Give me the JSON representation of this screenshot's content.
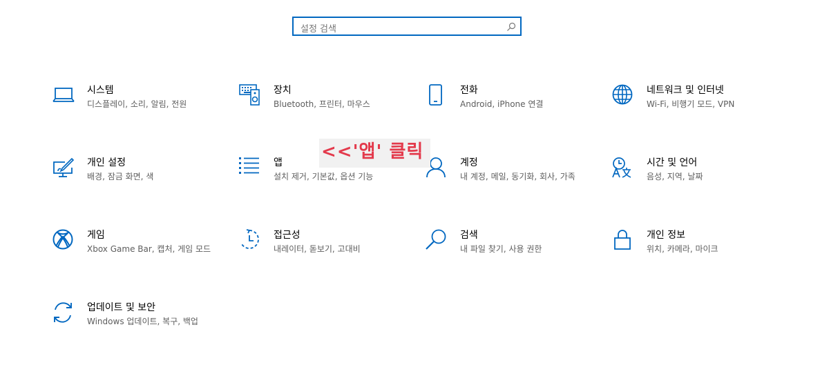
{
  "search": {
    "placeholder": "설정 검색"
  },
  "tiles": [
    {
      "title": "시스템",
      "desc": "디스플레이, 소리, 알림, 전원",
      "icon": "laptop-icon"
    },
    {
      "title": "장치",
      "desc": "Bluetooth, 프린터, 마우스",
      "icon": "devices-icon"
    },
    {
      "title": "전화",
      "desc": "Android, iPhone 연결",
      "icon": "phone-icon"
    },
    {
      "title": "네트워크 및 인터넷",
      "desc": "Wi-Fi, 비행기 모드, VPN",
      "icon": "globe-icon"
    },
    {
      "title": "개인 설정",
      "desc": "배경, 잠금 화면, 색",
      "icon": "personalization-icon"
    },
    {
      "title": "앱",
      "desc": "설치 제거, 기본값, 옵션 기능",
      "icon": "apps-list-icon"
    },
    {
      "title": "계정",
      "desc": "내 계정, 메일, 동기화, 회사, 가족",
      "icon": "person-icon"
    },
    {
      "title": "시간 및 언어",
      "desc": "음성, 지역, 날짜",
      "icon": "time-language-icon"
    },
    {
      "title": "게임",
      "desc": "Xbox Game Bar, 캡처, 게임 모드",
      "icon": "xbox-icon"
    },
    {
      "title": "접근성",
      "desc": "내레이터, 돋보기, 고대비",
      "icon": "ease-of-access-icon"
    },
    {
      "title": "검색",
      "desc": "내 파일 찾기, 사용 권한",
      "icon": "magnifier-icon"
    },
    {
      "title": "개인 정보",
      "desc": "위치, 카메라, 마이크",
      "icon": "lock-icon"
    },
    {
      "title": "업데이트 및 보안",
      "desc": "Windows 업데이트, 복구, 백업",
      "icon": "sync-icon"
    }
  ],
  "annotation": {
    "text": "<<'앱' 클릭"
  },
  "colors": {
    "accent": "#0067c0",
    "annotation": "#e33a4c",
    "annotation_bg": "#f1f1f1"
  }
}
